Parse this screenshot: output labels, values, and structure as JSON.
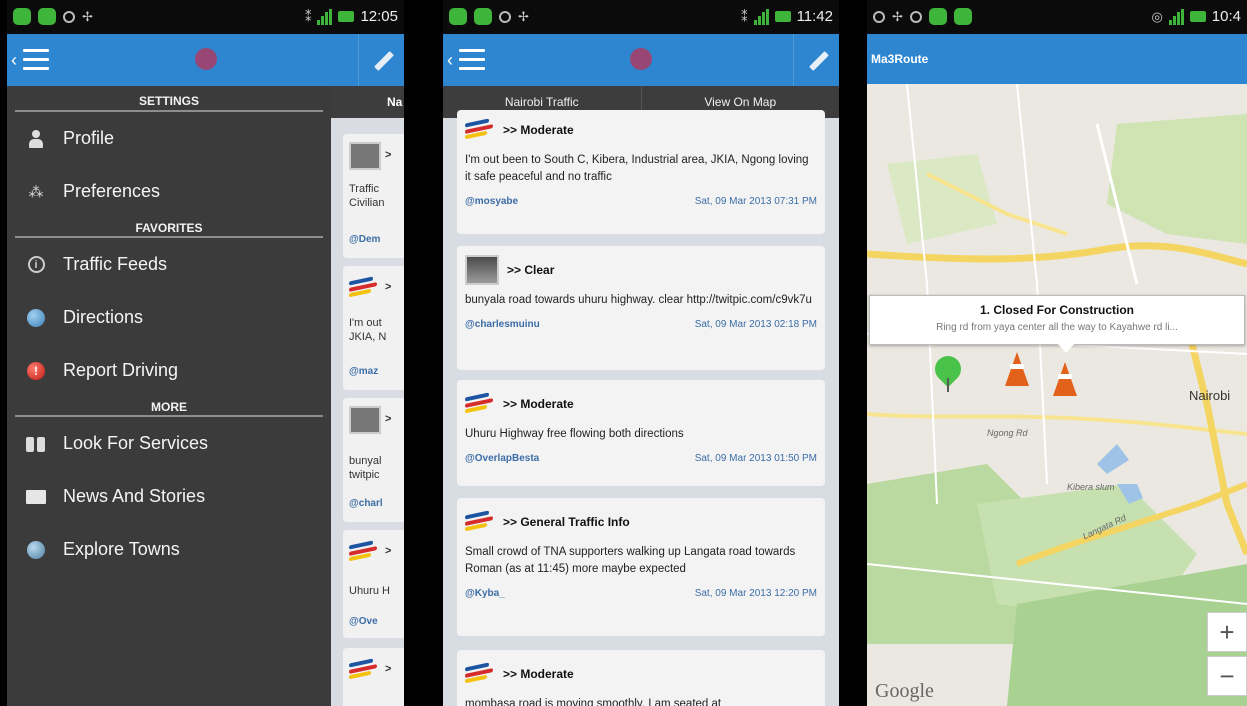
{
  "colors": {
    "action_bar": "#2d86cf",
    "drawer_bg": "#3b3b3b",
    "feed_bg": "#d8dde4",
    "link": "#3b6da6"
  },
  "screen1": {
    "time": "12:05",
    "drawer": {
      "sections": {
        "settings": "SETTINGS",
        "favorites": "FAVORITES",
        "more": "MORE"
      },
      "items": {
        "profile": "Profile",
        "preferences": "Preferences",
        "traffic_feeds": "Traffic Feeds",
        "directions": "Directions",
        "report_driving": "Report Driving",
        "look_for_services": "Look For Services",
        "news_and_stories": "News And Stories",
        "explore_towns": "Explore Towns"
      }
    },
    "peek": {
      "tab": "Na",
      "c1_title": ">",
      "c1_line1": "Traffic",
      "c1_line2": "Civilian",
      "c1_handle": "@Dem",
      "c2_title": ">",
      "c2_line1": "I'm out",
      "c2_line2": "JKIA, N",
      "c2_handle": "@maz",
      "c3_title": ">",
      "c3_line1": "bunyal",
      "c3_line2": "twitpic",
      "c3_handle": "@charl",
      "c4_title": ">",
      "c4_line1": "Uhuru H",
      "c4_handle": "@Ove",
      "c5_title": ">"
    }
  },
  "screen2": {
    "time": "11:42",
    "tabs": {
      "left": "Nairobi Traffic",
      "right": "View On Map"
    },
    "cards": [
      {
        "title": ">> Moderate",
        "text": "I'm out been to South C, Kibera, Industrial area, JKIA, Ngong loving it safe peaceful and no traffic",
        "handle": "@mosyabe",
        "time": "Sat, 09 Mar 2013 07:31 PM"
      },
      {
        "title": ">> Clear",
        "text": "bunyala road towards uhuru highway. clear http://twitpic.com/c9vk7u",
        "handle": "@charlesmuinu",
        "time": "Sat, 09 Mar 2013 02:18 PM"
      },
      {
        "title": ">> Moderate",
        "text": "Uhuru Highway free flowing both directions",
        "handle": "@OverlapBesta",
        "time": "Sat, 09 Mar 2013 01:50 PM"
      },
      {
        "title": ">> General Traffic Info",
        "text": "Small crowd of TNA supporters walking up Langata road towards Roman (as at 11:45) more maybe expected",
        "handle": "@Kyba_",
        "time": "Sat, 09 Mar 2013 12:20 PM"
      },
      {
        "title": ">> Moderate",
        "text": "mombasa road is moving smoothly. I am seated at",
        "handle": "",
        "time": ""
      }
    ]
  },
  "screen3": {
    "time": "10:4",
    "app_title": "Ma3Route",
    "popup": {
      "title": "1. Closed For Construction",
      "desc": "Ring rd from yaya center all the way to Kayahwe rd li..."
    },
    "places": {
      "nairobi": "Nairobi",
      "kibera": "Kibera slum",
      "langata": "Langata Rd",
      "ngong": "Ngong Rd"
    },
    "zoom_in": "+",
    "zoom_out": "−",
    "attribution": "Google"
  }
}
